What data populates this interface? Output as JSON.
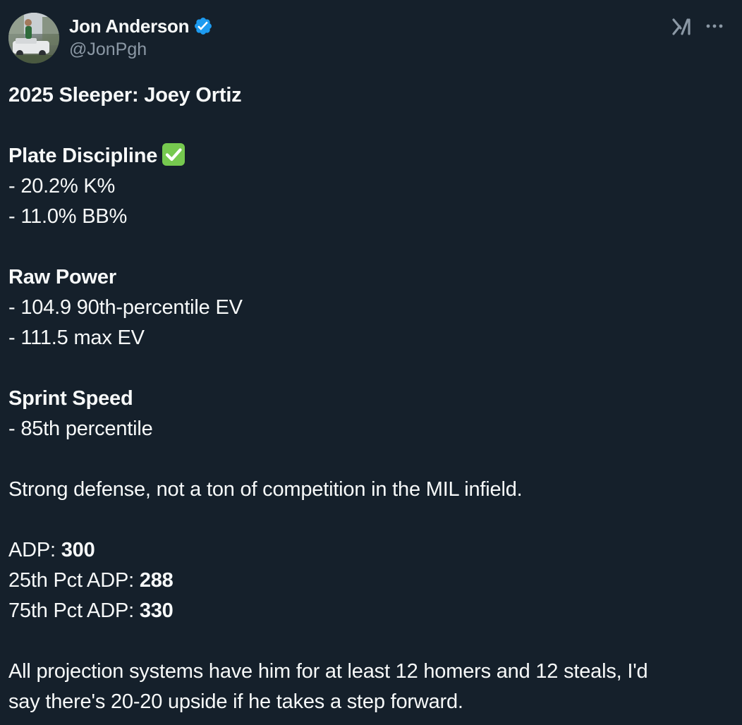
{
  "author": {
    "display_name": "Jon Anderson",
    "handle": "@JonPgh",
    "verified": true,
    "verified_color": "#1d9bf0"
  },
  "icons": {
    "verified": "verified-badge-icon",
    "grok": "grok-icon",
    "more": "more-options-icon",
    "check": "white-check-mark-emoji"
  },
  "tweet": {
    "title": "2025 Sleeper: Joey Ortiz",
    "plate_discipline": {
      "heading": "Plate Discipline",
      "items": [
        "- 20.2% K%",
        "- 11.0% BB%"
      ]
    },
    "raw_power": {
      "heading": "Raw Power",
      "items": [
        "- 104.9 90th-percentile EV",
        "- 111.5 max EV"
      ]
    },
    "sprint_speed": {
      "heading": "Sprint Speed",
      "items": [
        "- 85th percentile"
      ]
    },
    "defense_note": "Strong defense, not a ton of competition in the MIL infield.",
    "adp": [
      {
        "label": "ADP: ",
        "value": "300"
      },
      {
        "label": "25th Pct ADP: ",
        "value": "288"
      },
      {
        "label": "75th Pct ADP: ",
        "value": "330"
      }
    ],
    "closing_line_1": "All projection systems have him for at least 12 homers and 12 steals, I'd",
    "closing_line_2": "say there's 20-20 upside if he takes a step forward."
  },
  "colors": {
    "background": "#15202b",
    "text": "#f7f9f9",
    "secondary_text": "#8b98a5",
    "emoji_green": "#76c94f"
  }
}
